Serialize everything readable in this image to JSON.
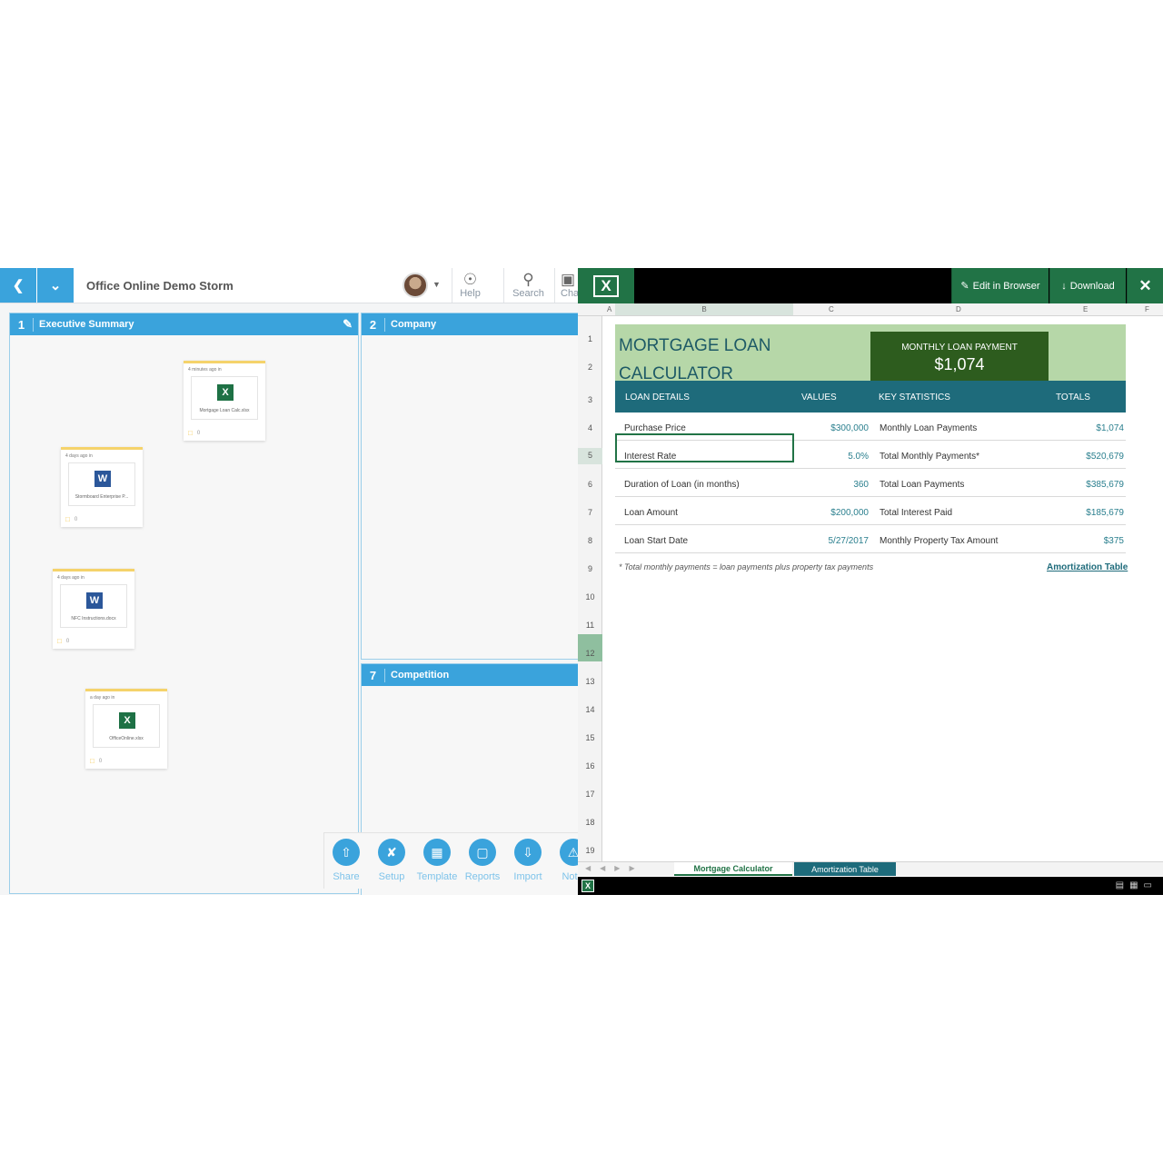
{
  "storm": {
    "title": "Office Online Demo Storm",
    "tools": [
      "Help",
      "Search",
      "Cha"
    ],
    "sections": [
      {
        "num": "1",
        "title": "Executive Summary"
      },
      {
        "num": "2",
        "title": "Company"
      },
      {
        "num": "7",
        "title": "Competition"
      }
    ],
    "cards": [
      {
        "time": "4 minutes ago in",
        "name": "Mortgage Loan Calc.xlsx",
        "type": "xl",
        "comments": "0"
      },
      {
        "time": "4 days ago in",
        "name": "Stormboard Enterprise P...",
        "type": "wd",
        "comments": "0"
      },
      {
        "time": "4 days ago in",
        "name": "NFC Instructions.docx",
        "type": "wd",
        "comments": "0"
      },
      {
        "time": "a day ago in",
        "name": "OfficeOnline.xlsx",
        "type": "xl",
        "comments": "0"
      }
    ],
    "bottom_tools": [
      "Share",
      "Setup",
      "Template",
      "Reports",
      "Import",
      "Notifi"
    ]
  },
  "excel": {
    "edit_label": "Edit in Browser",
    "download_label": "Download",
    "columns": [
      "A",
      "B",
      "C",
      "D",
      "E",
      "F"
    ],
    "rows": [
      "1",
      "2",
      "3",
      "4",
      "5",
      "6",
      "7",
      "8",
      "9",
      "10",
      "11",
      "12",
      "13",
      "14",
      "15",
      "16",
      "17",
      "18",
      "19"
    ],
    "title": "MORTGAGE LOAN CALCULATOR",
    "payment_label": "MONTHLY LOAN PAYMENT",
    "payment_value": "$1,074",
    "headers": [
      "LOAN DETAILS",
      "VALUES",
      "KEY STATISTICS",
      "TOTALS"
    ],
    "table": [
      {
        "label": "Purchase Price",
        "value": "$300,000",
        "stat": "Monthly Loan Payments",
        "total": "$1,074"
      },
      {
        "label": "Interest Rate",
        "value": "5.0%",
        "stat": "Total Monthly Payments*",
        "total": "$520,679"
      },
      {
        "label": "Duration of Loan (in months)",
        "value": "360",
        "stat": "Total Loan Payments",
        "total": "$385,679"
      },
      {
        "label": "Loan Amount",
        "value": "$200,000",
        "stat": "Total Interest Paid",
        "total": "$185,679"
      },
      {
        "label": "Loan Start Date",
        "value": "5/27/2017",
        "stat": "Monthly Property Tax Amount",
        "total": "$375"
      }
    ],
    "note": "* Total monthly payments = loan payments plus property tax payments",
    "amort_link": "Amortization Table",
    "tabs": [
      "Mortgage Calculator",
      "Amortization Table"
    ]
  }
}
